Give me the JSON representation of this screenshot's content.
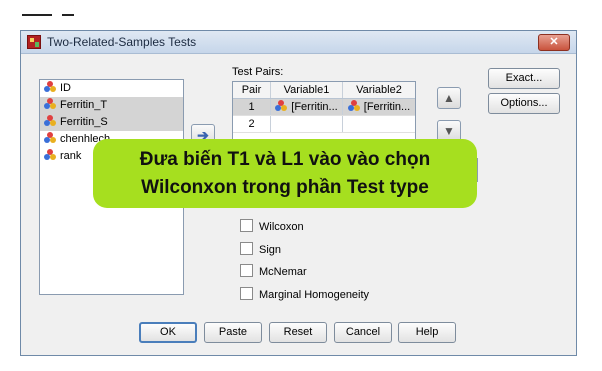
{
  "window": {
    "title": "Two-Related-Samples Tests",
    "close_label": "✕"
  },
  "variables": [
    {
      "name": "ID",
      "selected": false
    },
    {
      "name": "Ferritin_T",
      "selected": true
    },
    {
      "name": "Ferritin_S",
      "selected": true
    },
    {
      "name": "chenhlech",
      "selected": false
    },
    {
      "name": "rank",
      "selected": false
    }
  ],
  "test_pairs": {
    "label": "Test Pairs:",
    "columns": [
      "Pair",
      "Variable1",
      "Variable2"
    ],
    "rows": [
      {
        "pair": "1",
        "variable1": "[Ferritin...",
        "variable2": "[Ferritin..."
      },
      {
        "pair": "2",
        "variable1": "",
        "variable2": ""
      }
    ]
  },
  "side_buttons": {
    "exact": "Exact...",
    "options": "Options..."
  },
  "test_type": {
    "options": [
      {
        "label": "Wilcoxon",
        "checked": false
      },
      {
        "label": "Sign",
        "checked": false
      },
      {
        "label": "McNemar",
        "checked": false
      },
      {
        "label": "Marginal Homogeneity",
        "checked": false
      }
    ]
  },
  "bottom_buttons": {
    "ok": "OK",
    "paste": "Paste",
    "reset": "Reset",
    "cancel": "Cancel",
    "help": "Help"
  },
  "callout": {
    "line1": "Đưa biến T1 và L1 vào vào chọn",
    "line2": "Wilconxon trong phần Test type",
    "color": "#a6df1f"
  }
}
